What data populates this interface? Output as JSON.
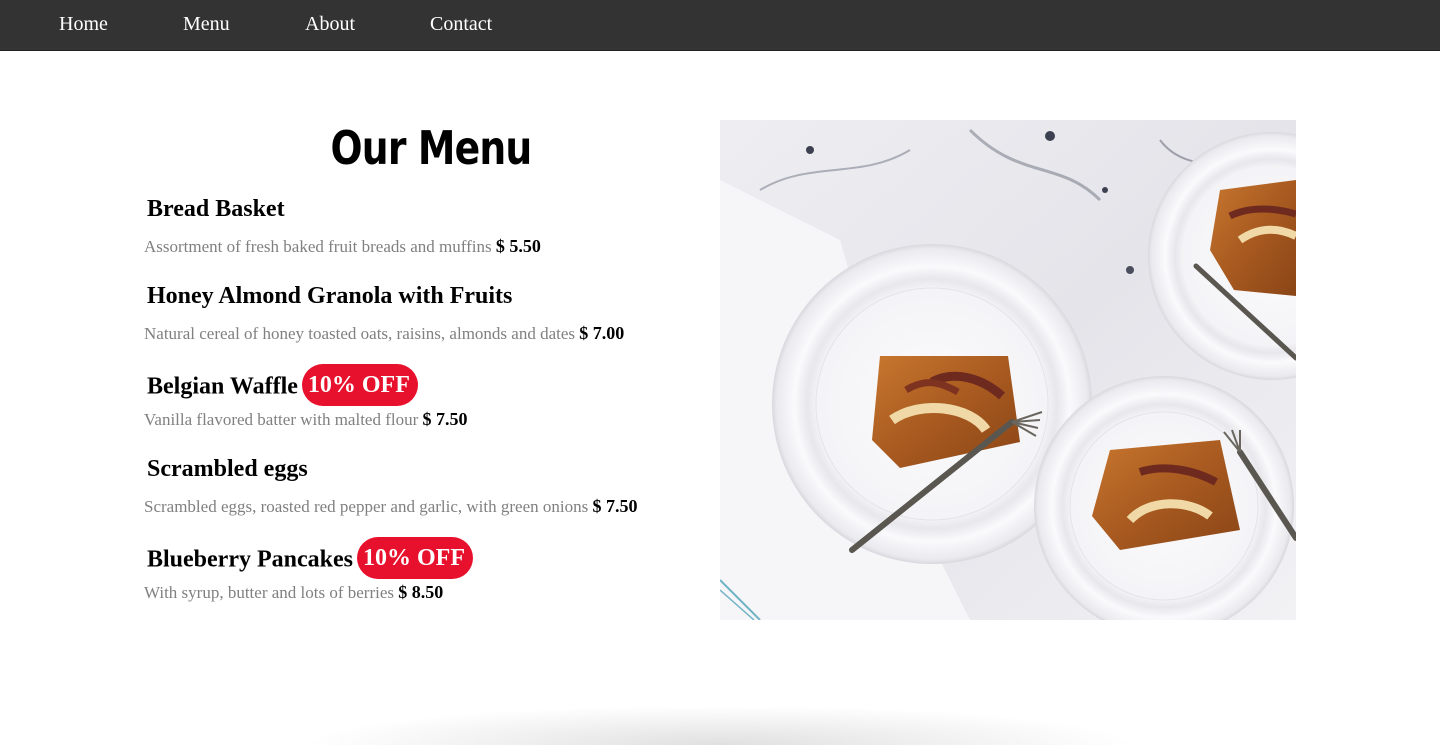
{
  "nav": {
    "items": [
      {
        "label": "Home"
      },
      {
        "label": "Menu"
      },
      {
        "label": "About"
      },
      {
        "label": "Contact"
      }
    ]
  },
  "menu": {
    "title": "Our Menu",
    "items": [
      {
        "name": "Bread Basket",
        "description": "Assortment of fresh baked fruit breads and muffins",
        "price": "$ 5.50",
        "badge": ""
      },
      {
        "name": "Honey Almond Granola with Fruits",
        "description": "Natural cereal of honey toasted oats, raisins, almonds and dates",
        "price": "$ 7.00",
        "badge": ""
      },
      {
        "name": "Belgian Waffle",
        "description": "Vanilla flavored batter with malted flour",
        "price": "$ 7.50",
        "badge": "10% OFF"
      },
      {
        "name": "Scrambled eggs",
        "description": "Scrambled eggs, roasted red pepper and garlic, with green onions",
        "price": "$ 7.50",
        "badge": ""
      },
      {
        "name": "Blueberry Pancakes",
        "description": "With syrup, butter and lots of berries",
        "price": "$ 8.50",
        "badge": "10% OFF"
      }
    ]
  },
  "colors": {
    "nav_bg": "#333333",
    "badge_bg": "#e8112d",
    "description_text": "#808080"
  },
  "photo": {
    "subject": "apple galette slices on white plates with forks on marble"
  }
}
